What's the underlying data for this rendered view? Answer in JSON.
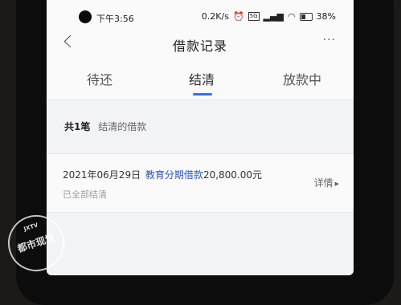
{
  "status_bar": {
    "time": "下午3:56",
    "network_speed": "0.2K/s",
    "network_type": "5G",
    "battery": "38%"
  },
  "header": {
    "title": "借款记录",
    "more_label": "···"
  },
  "tabs": [
    {
      "label": "待还",
      "active": false
    },
    {
      "label": "结清",
      "active": true
    },
    {
      "label": "放款中",
      "active": false
    }
  ],
  "summary": {
    "count": "共1笔",
    "description": "结清的借款"
  },
  "loans": [
    {
      "date": "2021年06月29日",
      "name": "教育分期借款",
      "amount": "20,800.00元",
      "status": "已全部结清",
      "detail_label": "详情"
    }
  ],
  "watermark": {
    "text": "都市现场",
    "subtext": "JXTV"
  },
  "colors": {
    "accent": "#3d6fd6",
    "background": "#f2f3f5"
  }
}
